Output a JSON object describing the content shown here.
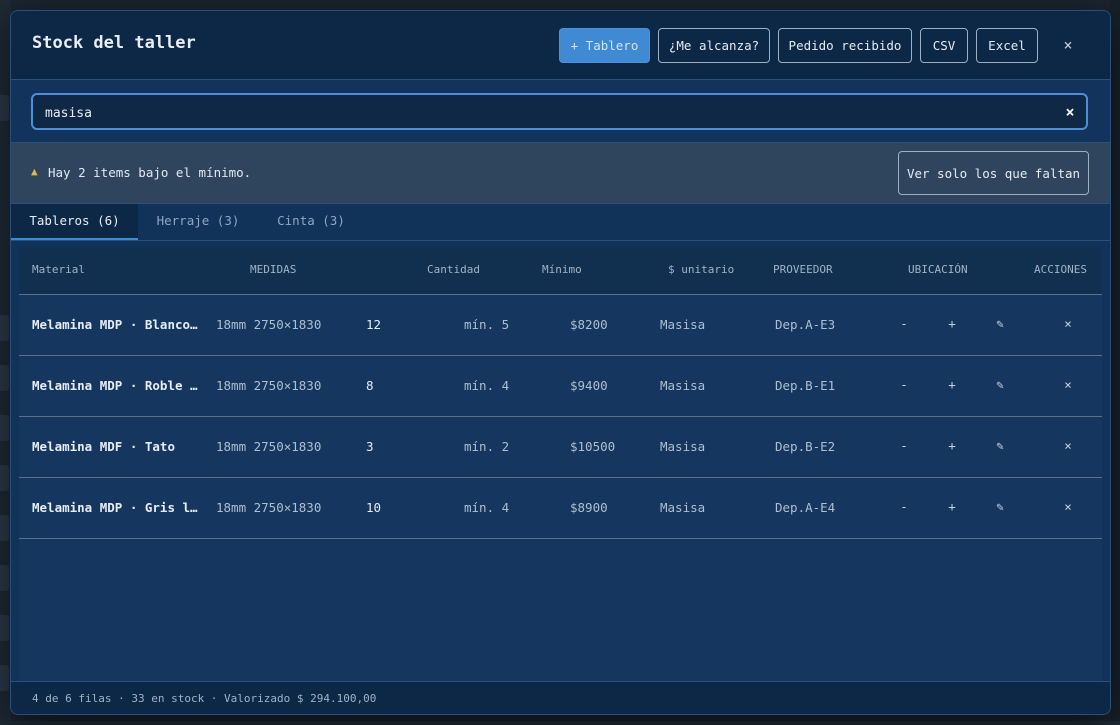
{
  "colors": {
    "accent": "#3f8ad3",
    "warning": "#e8b54a",
    "panel": "#113259"
  },
  "header": {
    "title": "Stock del taller",
    "buttons": {
      "add": "+ Tablero",
      "fit": "¿Me alcanza?",
      "received": "Pedido recibido",
      "csv": "CSV",
      "excel": "Excel"
    },
    "close": "×"
  },
  "search": {
    "value": "masisa",
    "clear": "×"
  },
  "alert": {
    "icon": "warning-icon",
    "text": "Hay 2 items bajo el mínimo.",
    "button": "Ver solo los que faltan"
  },
  "tabs": [
    "Tableros (6)",
    "Herraje (3)",
    "Cinta (3)"
  ],
  "table": {
    "headers": [
      "Material",
      "MEDIDAS",
      "Cantidad",
      "Mínimo",
      "$ unitario",
      "PROVEEDOR",
      "UBICACIÓN",
      "ACCIONES"
    ],
    "rows": [
      {
        "material": "Melamina MDP · Blanco…",
        "medidas": "18mm 2750×1830",
        "cantidad": "12",
        "minimo": "mín. 5",
        "unitario": "$8200",
        "proveedor": "Masisa",
        "ubicacion": "Dep.A-E3"
      },
      {
        "material": "Melamina MDP · Roble …",
        "medidas": "18mm 2750×1830",
        "cantidad": "8",
        "minimo": "mín. 4",
        "unitario": "$9400",
        "proveedor": "Masisa",
        "ubicacion": "Dep.B-E1"
      },
      {
        "material": "Melamina MDF · Tato",
        "medidas": "18mm 2750×1830",
        "cantidad": "3",
        "minimo": "mín. 2",
        "unitario": "$10500",
        "proveedor": "Masisa",
        "ubicacion": "Dep.B-E2"
      },
      {
        "material": "Melamina MDP · Gris l…",
        "medidas": "18mm 2750×1830",
        "cantidad": "10",
        "minimo": "mín. 4",
        "unitario": "$8900",
        "proveedor": "Masisa",
        "ubicacion": "Dep.A-E4"
      }
    ],
    "actions": {
      "minus": "-",
      "plus": "+",
      "edit": "✎",
      "delete": "×"
    }
  },
  "footer": {
    "text": "4 de 6 filas · 33 en stock · Valorizado $ 294.100,00"
  }
}
